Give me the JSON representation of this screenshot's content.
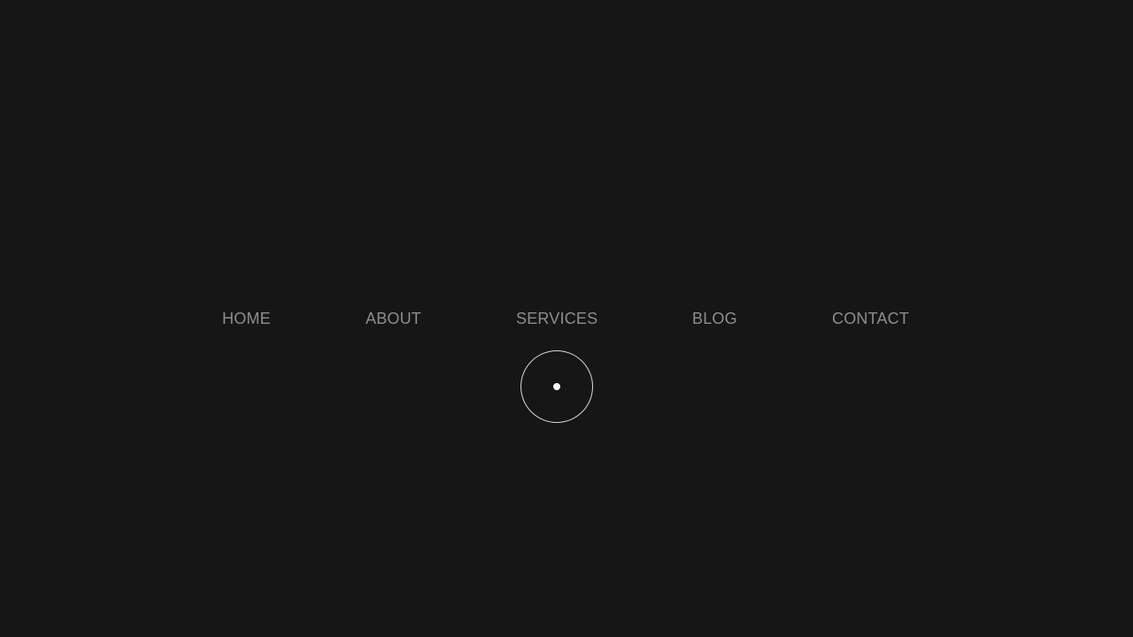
{
  "nav": {
    "items": [
      {
        "label": "HOME"
      },
      {
        "label": "ABOUT"
      },
      {
        "label": "SERVICES"
      },
      {
        "label": "BLOG"
      },
      {
        "label": "CONTACT"
      }
    ]
  },
  "colors": {
    "background": "#161616",
    "nav_text": "#8d8d8d",
    "cursor_ring": "#d9d9d9",
    "cursor_dot": "#ffffff"
  }
}
